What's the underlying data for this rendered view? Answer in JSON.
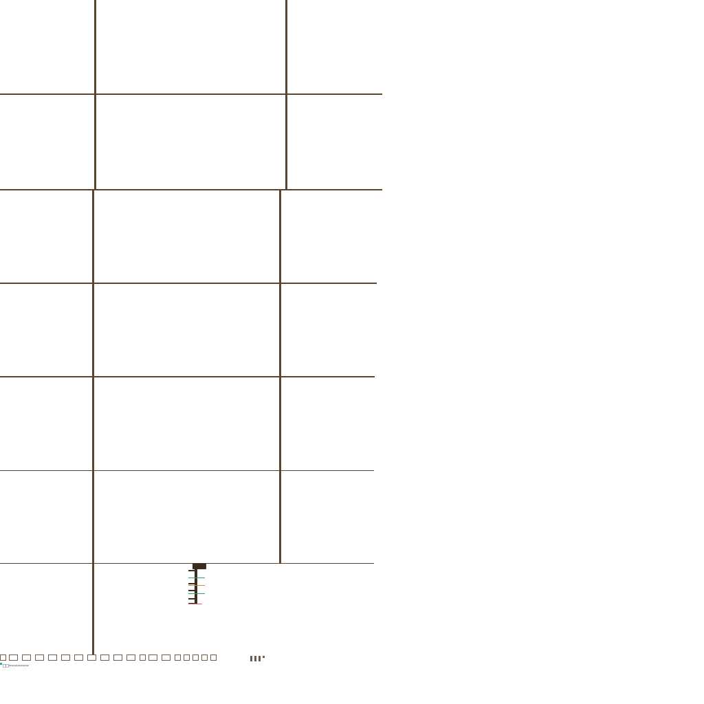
{
  "colors": {
    "line": "#5a4630",
    "line_dark": "#3a2c1e",
    "accent_green": "#2aa36f",
    "accent_red": "#c86a6a",
    "accent_orange": "#d08a3a",
    "accent_teal": "#2bb0b0"
  },
  "footer": {
    "tiny_label": "□□▱▱▱▱▱▱▱"
  },
  "icons": {
    "widget": "level-indicator-icon",
    "strip_marker": "hash-marker-icon"
  }
}
